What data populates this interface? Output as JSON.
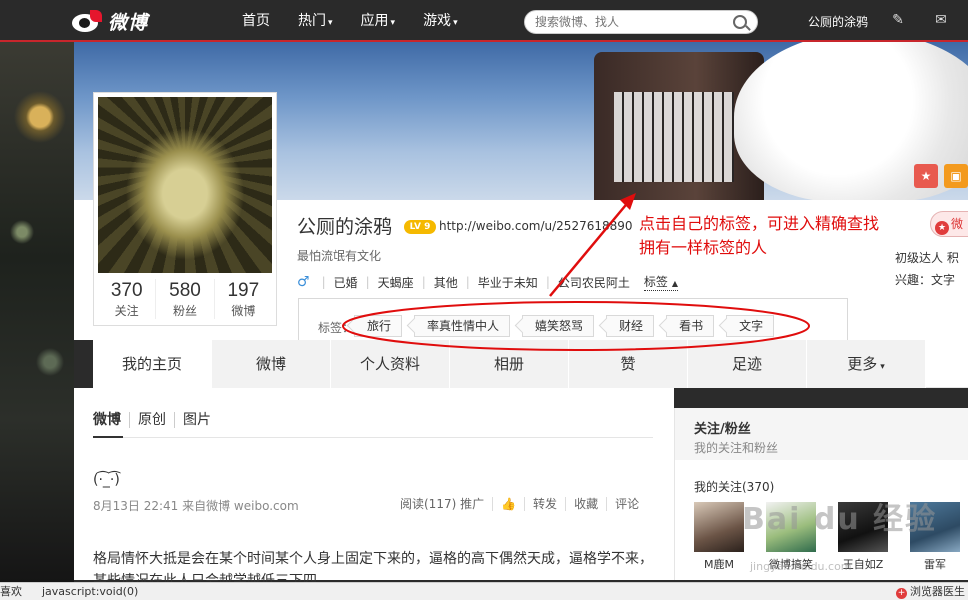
{
  "topbar": {
    "logo_text": "微博",
    "nav": [
      {
        "label": "首页",
        "caret": ""
      },
      {
        "label": "热门",
        "caret": "▾"
      },
      {
        "label": "应用",
        "caret": "▾"
      },
      {
        "label": "游戏",
        "caret": "▾"
      }
    ],
    "search_placeholder": "搜索微博、找人",
    "user_name": "公厕的涂鸦"
  },
  "profile": {
    "name": "公厕的涂鸦",
    "level": "LV 9",
    "url": "http://weibo.com/u/2527618890",
    "description": "最怕流氓有文化",
    "gender_icon": "♂",
    "info": [
      "已婚",
      "天蝎座",
      "其他",
      "毕业于未知",
      "公司农民阿土"
    ],
    "tags_toggle": "标签",
    "right_button": "微",
    "right_line1": "初级达人  积",
    "right_line2": "兴趣：文字",
    "stats": [
      {
        "num": "370",
        "label": "关注"
      },
      {
        "num": "580",
        "label": "粉丝"
      },
      {
        "num": "197",
        "label": "微博"
      }
    ]
  },
  "tags": {
    "label": "标签：",
    "items": [
      "旅行",
      "率真性情中人",
      "嬉笑怒骂",
      "财经",
      "看书",
      "文字"
    ]
  },
  "annotation": {
    "line1": "点击自己的标签，可进入精确查找",
    "line2": "拥有一样标签的人"
  },
  "tabs": [
    {
      "label": "我的主页",
      "caret": ""
    },
    {
      "label": "微博",
      "caret": ""
    },
    {
      "label": "个人资料",
      "caret": ""
    },
    {
      "label": "相册",
      "caret": ""
    },
    {
      "label": "赞",
      "caret": ""
    },
    {
      "label": "足迹",
      "caret": ""
    },
    {
      "label": "更多",
      "caret": "▾"
    }
  ],
  "feed": {
    "subtabs": [
      "微博",
      "原创",
      "图片"
    ],
    "post_face": "(·͡_·͡)",
    "post_meta": "8月13日 22:41  来自微博 weibo.com",
    "actions": [
      "阅读(117)  推广",
      "👍",
      "转发",
      "收藏",
      "评论"
    ],
    "post_text": "格局情怀大抵是会在某个时间某个人身上固定下来的，逼格的高下偶然天成，逼格学不来，某些情况在此人只会越学越低三下四"
  },
  "sidebar": {
    "title": "关注/粉丝",
    "subtitle": "我的关注和粉丝",
    "follow_title": "我的关注(370)",
    "follows": [
      "M鹿M",
      "微博搞笑",
      "王自如Z",
      "雷军"
    ]
  },
  "watermark": {
    "main": "Bai du 经验",
    "sub": "jingyan.baidu.com"
  },
  "statusbar": {
    "left": "喜欢",
    "middle": "javascript:void(0)",
    "right": "浏览器医生"
  },
  "colors": {
    "accent": "#c8262c",
    "annotation": "#e00d0d",
    "link": "#3b8fd9"
  }
}
